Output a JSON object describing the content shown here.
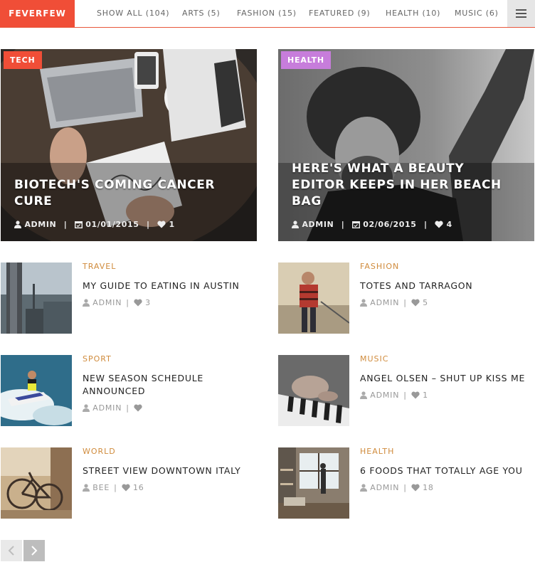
{
  "brand": "FEVERFEW",
  "nav": {
    "tabs": [
      {
        "label": "SHOW ALL (104)"
      },
      {
        "label": "ARTS (5)"
      },
      {
        "label": "FASHION (15)"
      },
      {
        "label": "FEATURED (9)"
      },
      {
        "label": "HEALTH (10)"
      },
      {
        "label": "MUSIC (6)"
      }
    ],
    "menu_icon": "hamburger-menu-icon"
  },
  "featured": [
    {
      "category": "TECH",
      "category_color": "#f04e37",
      "title": "BIOTECH'S COMING CANCER CURE",
      "author": "ADMIN",
      "date": "01/01/2015",
      "likes": "1"
    },
    {
      "category": "HEALTH",
      "category_color": "#c77ddb",
      "title": "HERE'S WHAT A BEAUTY EDITOR KEEPS IN HER BEACH BAG",
      "author": "ADMIN",
      "date": "02/06/2015",
      "likes": "4"
    }
  ],
  "posts": [
    {
      "category": "TRAVEL",
      "title": "MY GUIDE TO EATING IN AUSTIN",
      "author": "ADMIN",
      "likes": "3"
    },
    {
      "category": "FASHION",
      "title": "TOTES AND TARRAGON",
      "author": "ADMIN",
      "likes": "5"
    },
    {
      "category": "SPORT",
      "title": "NEW SEASON SCHEDULE ANNOUNCED",
      "author": "ADMIN",
      "likes": ""
    },
    {
      "category": "MUSIC",
      "title": "ANGEL OLSEN – SHUT UP KISS ME",
      "author": "ADMIN",
      "likes": "1"
    },
    {
      "category": "WORLD",
      "title": "STREET VIEW DOWNTOWN ITALY",
      "author": "BEE",
      "likes": "16"
    },
    {
      "category": "HEALTH",
      "title": "6 FOODS THAT TOTALLY AGE YOU",
      "author": "ADMIN",
      "likes": "18"
    }
  ],
  "separator": "|",
  "pager": {
    "prev_icon": "chevron-left-icon",
    "next_icon": "chevron-right-icon"
  },
  "colors": {
    "accent": "#f04e37",
    "category_text": "#d08b3c",
    "meta_text": "#999999"
  }
}
